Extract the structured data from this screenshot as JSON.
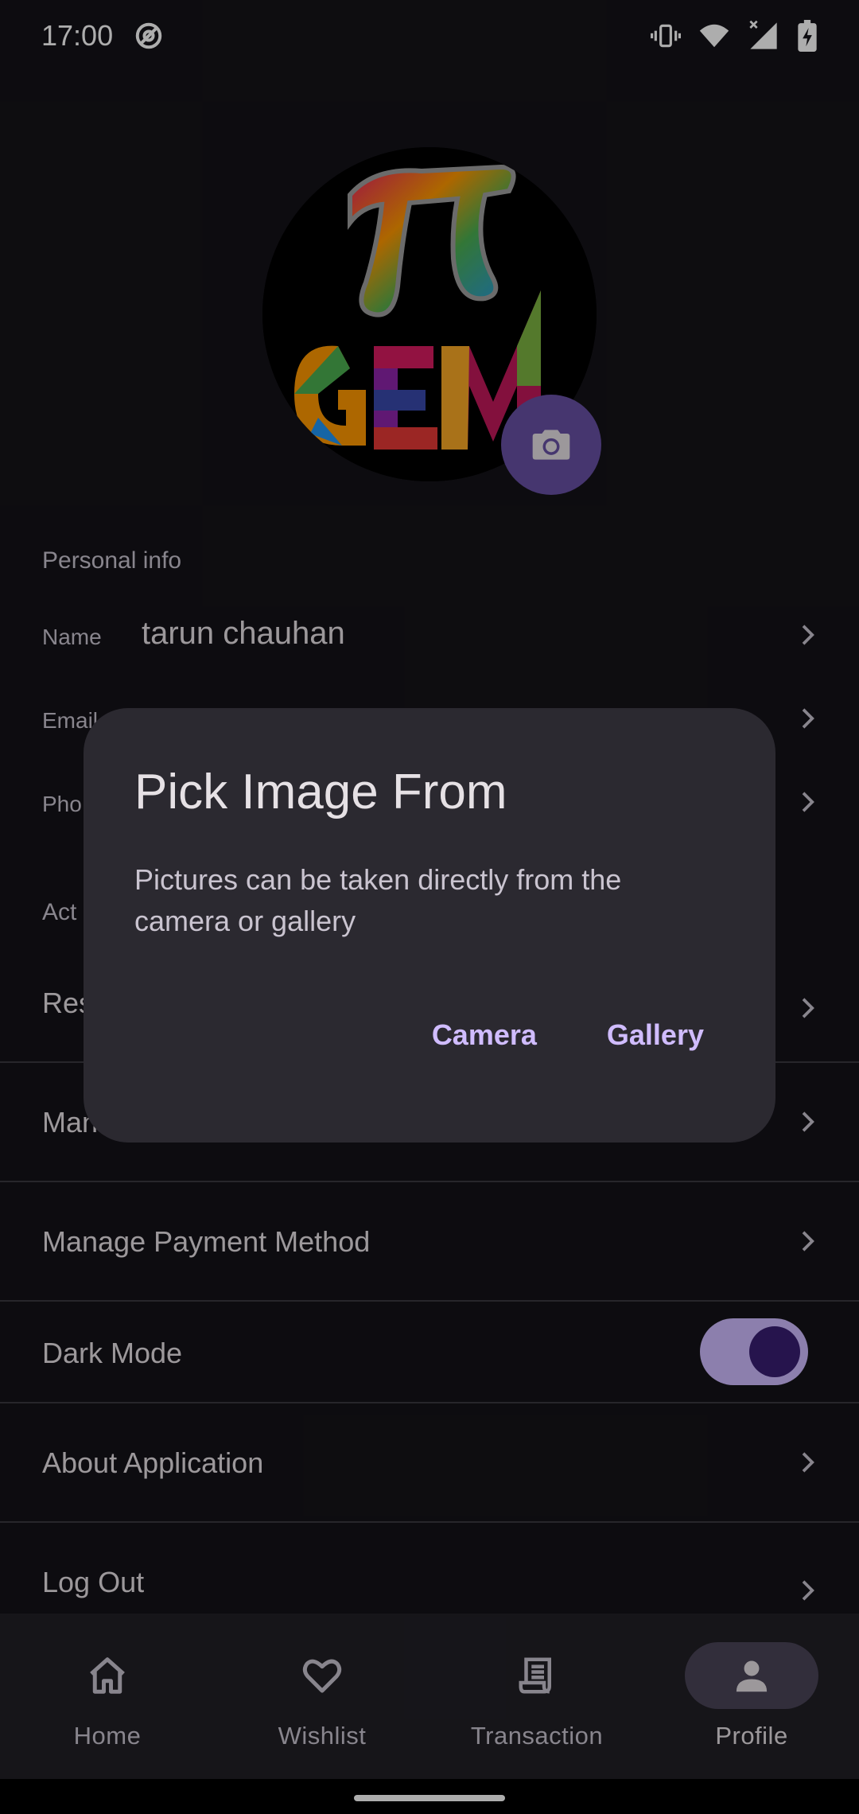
{
  "status_bar": {
    "time": "17:00"
  },
  "profile": {
    "personal_info_label": "Personal info",
    "name_label": "Name",
    "name_value": "tarun chauhan",
    "email_label": "Email",
    "phone_label": "Pho",
    "account_label": "Act",
    "reset_label": "Res",
    "manage_label": "Man"
  },
  "settings": {
    "manage_payment": "Manage Payment Method",
    "dark_mode": "Dark Mode",
    "dark_mode_on": true,
    "about": "About Application",
    "logout": "Log Out"
  },
  "bottom_nav": {
    "items": [
      {
        "label": "Home",
        "icon": "home-icon",
        "active": false
      },
      {
        "label": "Wishlist",
        "icon": "heart-icon",
        "active": false
      },
      {
        "label": "Transaction",
        "icon": "receipt-icon",
        "active": false
      },
      {
        "label": "Profile",
        "icon": "person-icon",
        "active": true
      }
    ]
  },
  "dialog": {
    "title": "Pick Image From",
    "body": "Pictures can be taken directly from the camera or gallery",
    "camera_button": "Camera",
    "gallery_button": "Gallery"
  },
  "colors": {
    "background": "#141318",
    "accent": "#d0bcff",
    "dialog": "#2b2930",
    "fab": "#6750a4"
  }
}
